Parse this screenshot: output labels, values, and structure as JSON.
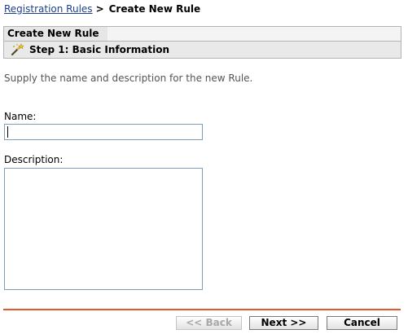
{
  "breadcrumb": {
    "parent_label": "Registration Rules",
    "separator": ">",
    "current_label": "Create New Rule"
  },
  "panel": {
    "title": "Create New Rule",
    "step_label": "Step 1: Basic Information",
    "step_icon": "wand-icon"
  },
  "instructions": "Supply the name and description for the new Rule.",
  "form": {
    "name_label": "Name:",
    "name_value": "",
    "description_label": "Description:",
    "description_value": ""
  },
  "buttons": {
    "back_label": "<< Back",
    "next_label": "Next >>",
    "cancel_label": "Cancel"
  },
  "colors": {
    "link": "#1d3f8f",
    "divider": "#e05a28",
    "input_border": "#7f9db9"
  }
}
